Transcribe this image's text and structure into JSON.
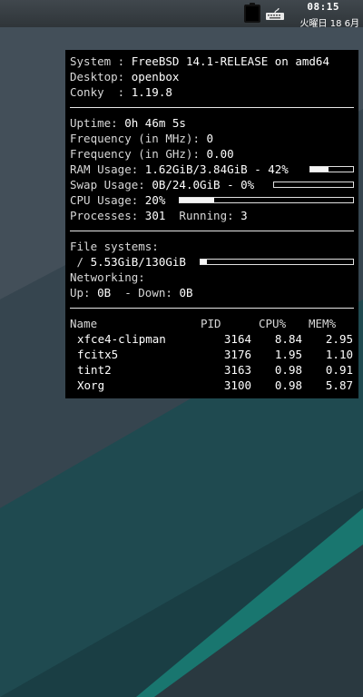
{
  "panel": {
    "time": "08:15",
    "date": "火曜日 18 6月",
    "tray": [
      "clipboard-icon",
      "keyboard-icon"
    ]
  },
  "conky": {
    "system_label": "System : ",
    "system_value": "FreeBSD 14.1-RELEASE on amd64",
    "desktop_label": "Desktop: ",
    "desktop_value": "openbox",
    "conky_label": "Conky  : ",
    "conky_value": "1.19.8",
    "uptime_label": "Uptime: ",
    "uptime_value": "0h 46m 5s",
    "freq_mhz_label": "Frequency (in MHz): ",
    "freq_mhz_value": "0",
    "freq_ghz_label": "Frequency (in GHz): ",
    "freq_ghz_value": "0.00",
    "ram_label": "RAM Usage: ",
    "ram_value": "1.62GiB/3.84GiB - 42%",
    "ram_fraction": 0.42,
    "swap_label": "Swap Usage: ",
    "swap_value": "0B/24.0GiB - 0%",
    "swap_fraction": 0.0,
    "cpu_label": "CPU Usage: ",
    "cpu_value": "20%",
    "cpu_fraction": 0.2,
    "processes_label": "Processes: ",
    "processes_value": "301",
    "running_label": "  Running: ",
    "running_value": "3",
    "fs_title": "File systems:",
    "fs_root_label": " / ",
    "fs_root_value": "5.53GiB/130GiB",
    "fs_root_fraction": 0.04,
    "net_title": "Networking:",
    "net_up_label": "Up: ",
    "net_up_value": "0B",
    "net_down_label": "  - Down: ",
    "net_down_value": "0B",
    "proc_header": {
      "name": "Name",
      "pid": "PID",
      "cpu": "CPU%",
      "mem": "MEM%"
    },
    "proc_rows": [
      {
        "name": "xfce4-clipman",
        "pid": "3164",
        "cpu": "8.84",
        "mem": "2.95"
      },
      {
        "name": "fcitx5",
        "pid": "3176",
        "cpu": "1.95",
        "mem": "1.10"
      },
      {
        "name": "tint2",
        "pid": "3163",
        "cpu": "0.98",
        "mem": "0.91"
      },
      {
        "name": "Xorg",
        "pid": "3100",
        "cpu": "0.98",
        "mem": "5.87"
      }
    ]
  },
  "colors": {
    "wallpaper_base": "#3b4a55",
    "wallpaper_teal": "#1e4a4f",
    "accent_stripe": "#1f8a80",
    "conky_bg": "#000000",
    "conky_text": "#d8d8d8"
  }
}
